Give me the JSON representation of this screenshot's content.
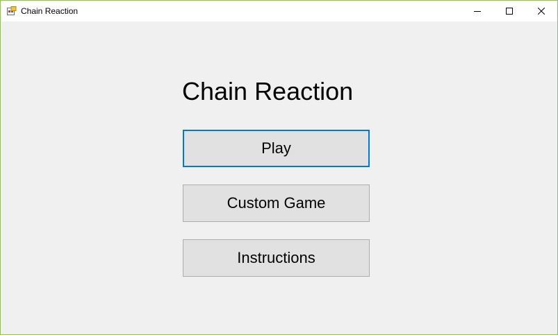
{
  "window": {
    "title": "Chain Reaction",
    "icon": "winforms-app-icon",
    "controls": {
      "minimize_icon": "minimize-icon",
      "maximize_icon": "maximize-icon",
      "close_icon": "close-icon"
    }
  },
  "main": {
    "heading": "Chain Reaction",
    "buttons": [
      {
        "label": "Play",
        "focused": true
      },
      {
        "label": "Custom Game",
        "focused": false
      },
      {
        "label": "Instructions",
        "focused": false
      }
    ]
  },
  "colors": {
    "window_border": "#8cc63f",
    "background": "#f0f0f0",
    "button_face": "#e1e1e1",
    "button_border": "#adadad",
    "focus_border": "#0078d7"
  }
}
